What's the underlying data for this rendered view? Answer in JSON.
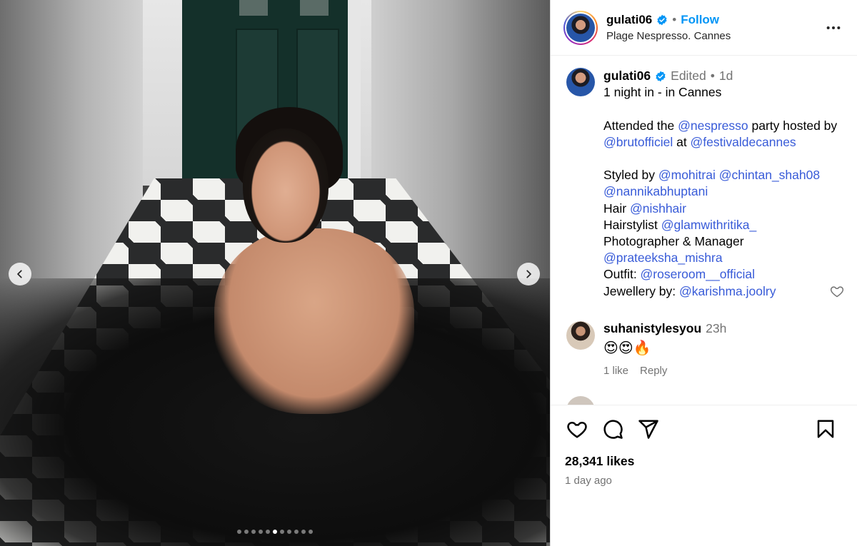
{
  "post": {
    "username": "gulati06",
    "location": "Plage Nespresso. Cannes",
    "follow_label": "Follow",
    "separator": "•",
    "media": {
      "slide_count": 11,
      "active_slide": 5,
      "prev_icon": "chevron-left-icon",
      "next_icon": "chevron-right-icon"
    }
  },
  "caption": {
    "username": "gulati06",
    "edited": "Edited",
    "separator": "•",
    "age": "1d",
    "line1": "1 night in - in Cannes",
    "l3_a": "Attended the ",
    "l3_m1": "@nespresso",
    "l3_b": " party hosted by",
    "l4_m1": "@brutofficiel",
    "l4_a": " at ",
    "l4_m2": "@festivaldecannes",
    "l6_a": "Styled by ",
    "l6_m1": "@mohitrai",
    "l6_sp": " ",
    "l6_m2": "@chintan_shah08",
    "l7_m1": "@nannikabhuptani",
    "l8_a": "Hair ",
    "l8_m1": "@nishhair",
    "l9_a": "Hairstylist ",
    "l9_m1": "@glamwithritika_",
    "l10_a": "Photographer & Manager",
    "l11_m1": "@prateeksha_mishra",
    "l12_a": "Outfit: ",
    "l12_m1": "@roseroom__official",
    "l13_a": "Jewellery by: ",
    "l13_m1": "@karishma.joolry"
  },
  "comment": {
    "username": "suhanistylesyou",
    "age": "23h",
    "text": "😍😍🔥",
    "likes": "1 like",
    "reply": "Reply"
  },
  "next_comment_peek": "",
  "footer": {
    "likes": "28,341 likes",
    "time": "1 day ago"
  },
  "colors": {
    "follow": "#0095f6",
    "mention": "#385bd8",
    "muted": "#737373",
    "verified": "#0095f6"
  }
}
